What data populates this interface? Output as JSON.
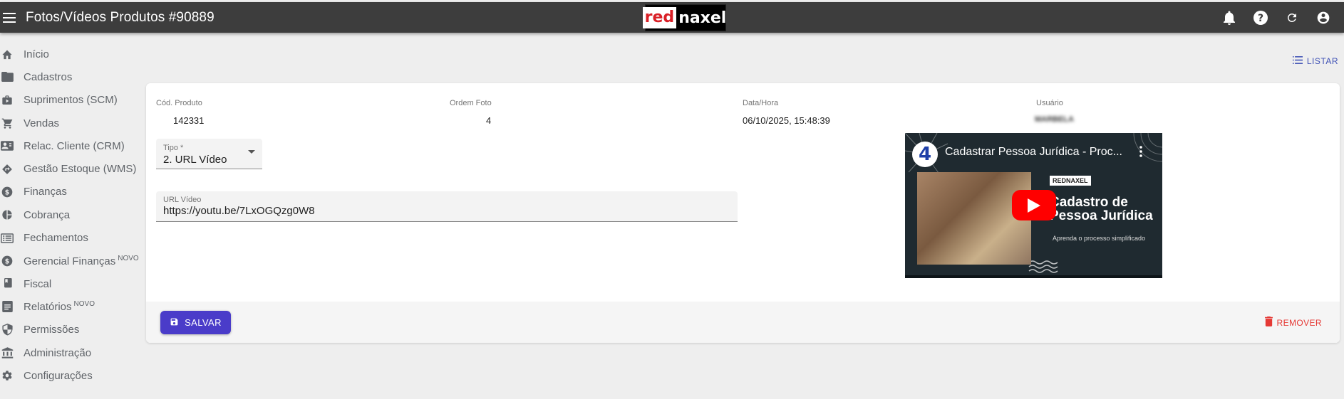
{
  "header": {
    "title": "Fotos/Vídeos Produtos #90889",
    "logo_red": "red",
    "logo_rest": "naxel",
    "icons": [
      "menu-icon",
      "bell-icon",
      "help-icon",
      "refresh-icon",
      "account-icon"
    ]
  },
  "sidebar": {
    "items": [
      {
        "label": "Início",
        "icon": "home-icon",
        "badge": ""
      },
      {
        "label": "Cadastros",
        "icon": "folder-icon",
        "badge": ""
      },
      {
        "label": "Suprimentos (SCM)",
        "icon": "supplies-icon",
        "badge": ""
      },
      {
        "label": "Vendas",
        "icon": "cart-icon",
        "badge": ""
      },
      {
        "label": "Relac. Cliente (CRM)",
        "icon": "contact-card-icon",
        "badge": ""
      },
      {
        "label": "Gestão Estoque (WMS)",
        "icon": "directions-icon",
        "badge": ""
      },
      {
        "label": "Finanças",
        "icon": "dollar-icon",
        "badge": ""
      },
      {
        "label": "Cobrança",
        "icon": "pie-icon",
        "badge": ""
      },
      {
        "label": "Fechamentos",
        "icon": "list-box-icon",
        "badge": ""
      },
      {
        "label": "Gerencial Finanças",
        "icon": "dollar-icon",
        "badge": "NOVO"
      },
      {
        "label": "Fiscal",
        "icon": "book-icon",
        "badge": ""
      },
      {
        "label": "Relatórios",
        "icon": "report-icon",
        "badge": "NOVO"
      },
      {
        "label": "Permissões",
        "icon": "shield-icon",
        "badge": ""
      },
      {
        "label": "Administração",
        "icon": "bank-icon",
        "badge": ""
      },
      {
        "label": "Configurações",
        "icon": "gear-icon",
        "badge": ""
      }
    ]
  },
  "actions": {
    "list_label": "LISTAR",
    "save_label": "SALVAR",
    "remove_label": "REMOVER"
  },
  "form": {
    "cod_produto_label": "Cód. Produto",
    "cod_produto_value": "142331",
    "ordem_foto_label": "Ordem Foto",
    "ordem_foto_value": "4",
    "data_hora_label": "Data/Hora",
    "data_hora_value": "06/10/2025, 15:48:39",
    "usuario_label": "Usuário",
    "usuario_value": "MARBELA",
    "tipo_label": "Tipo *",
    "tipo_value": "2. URL Vídeo",
    "url_label": "URL Vídeo",
    "url_value": "https://youtu.be/7LxOGQzg0W8"
  },
  "video": {
    "badge": "4",
    "title": "Cadastrar Pessoa Jurídica - Proc...",
    "brand": "REDNAXEL",
    "headline_line1": "Cadastro de",
    "headline_line2": "Pessoa Jurídica",
    "subtitle": "Aprenda o processo simplificado"
  },
  "colors": {
    "topbar": "#3d3d3d",
    "primary": "#4a3cc9",
    "link": "#3f51b5",
    "danger": "#e53935",
    "youtube_red": "#ff0000"
  }
}
